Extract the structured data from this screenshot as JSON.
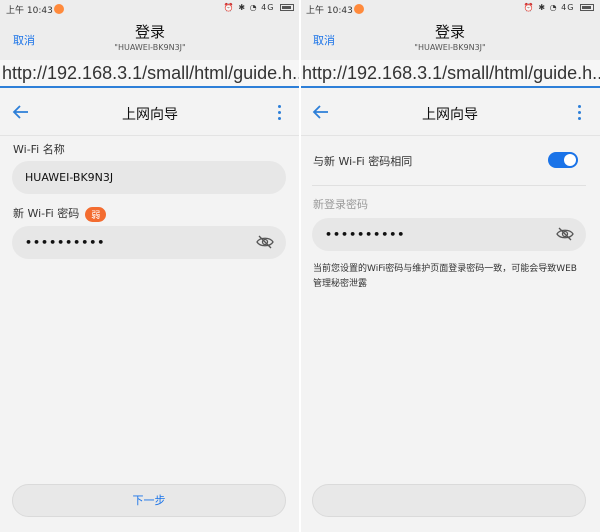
{
  "status_bar": {
    "time": "上午 10:43",
    "network": "4G"
  },
  "web_header": {
    "cancel_label": "取消",
    "title": "登录",
    "subtitle": "\"HUAWEI-BK9N3J\""
  },
  "url": "http://192.168.3.1/small/html/guide.h...",
  "app_bar": {
    "title": "上网向导"
  },
  "left_panel": {
    "wifi_name_label": "Wi-Fi 名称",
    "wifi_name_value": "HUAWEI-BK9N3J",
    "wifi_password_label": "新 Wi-Fi 密码",
    "strength_badge": "弱",
    "wifi_password_value": "••••••••••",
    "next_button": "下一步"
  },
  "right_panel": {
    "same_as_wifi_label": "与新 Wi-Fi 密码相同",
    "same_as_wifi_on": true,
    "login_password_label": "新登录密码",
    "login_password_value": "••••••••••",
    "hint_text": "当前您设置的WiFi密码与维护页面登录密码一致，可能会导致WEB管理秘密泄露"
  },
  "colors": {
    "accent": "#1a73e8",
    "badge": "#f36c30"
  }
}
